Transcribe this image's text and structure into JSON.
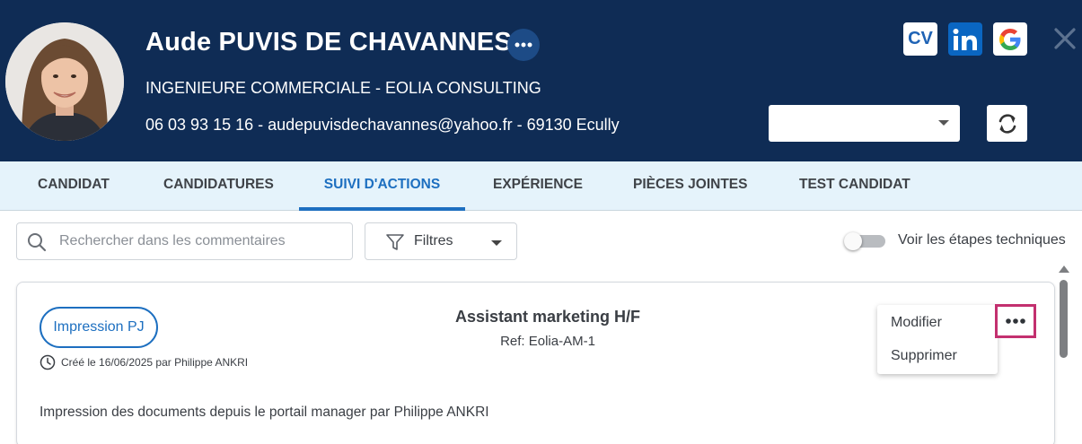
{
  "candidate": {
    "name": "Aude PUVIS DE CHAVANNES",
    "job_title": "INGENIEURE COMMERCIALE - EOLIA CONSULTING",
    "contact": "06 03 93 15 16 - audepuvisdechavannes@yahoo.fr - 69130 Ecully"
  },
  "header_actions": {
    "more_icon": "ellipsis-icon",
    "cv_label": "CV",
    "linkedin_icon": "linkedin-icon",
    "google_icon": "google-icon",
    "close_icon": "close-icon",
    "status_select_value": "",
    "refresh_icon": "refresh-icon"
  },
  "tabs": [
    {
      "label": "CANDIDAT",
      "active": false
    },
    {
      "label": "CANDIDATURES",
      "active": false
    },
    {
      "label": "SUIVI D'ACTIONS",
      "active": true
    },
    {
      "label": "EXPÉRIENCE",
      "active": false
    },
    {
      "label": "PIÈCES JOINTES",
      "active": false
    },
    {
      "label": "TEST CANDIDAT",
      "active": false
    }
  ],
  "toolbar": {
    "search_placeholder": "Rechercher dans les commentaires",
    "filters_label": "Filtres",
    "toggle_label": "Voir les étapes techniques",
    "toggle_on": false
  },
  "action_card": {
    "type_label": "Impression PJ",
    "created": "Créé le 16/06/2025 par Philippe ANKRI",
    "title": "Assistant marketing H/F",
    "ref": "Ref: Eolia-AM-1",
    "comment": "Impression des documents depuis le portail manager par Philippe ANKRI"
  },
  "context_menu": {
    "items": [
      "Modifier",
      "Supprimer"
    ]
  },
  "colors": {
    "header_bg": "#0f2c55",
    "accent": "#1d6fc0",
    "tabs_bg": "#e5f3fb",
    "highlight": "#c3306f"
  }
}
